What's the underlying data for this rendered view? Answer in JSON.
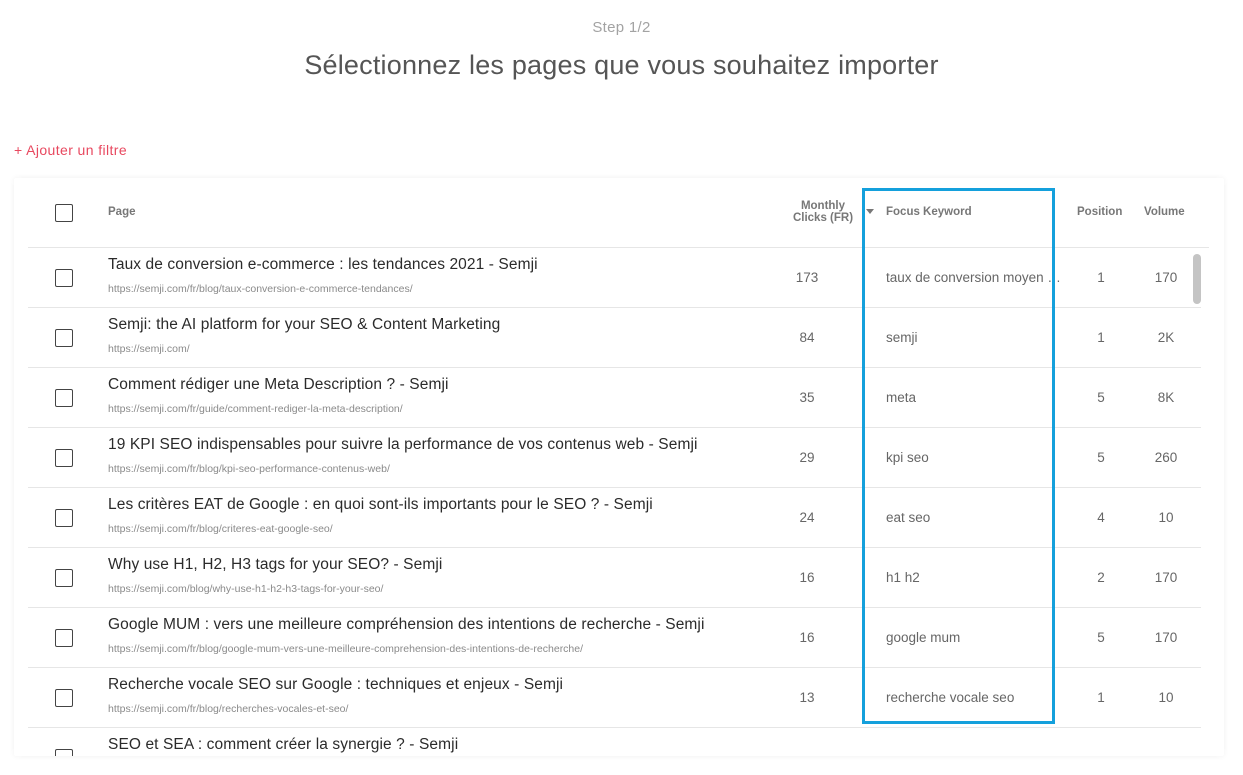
{
  "header": {
    "step": "Step 1/2",
    "title": "Sélectionnez les pages que vous souhaitez importer",
    "add_filter": "+ Ajouter un filtre"
  },
  "table": {
    "columns": {
      "page": "Page",
      "clicks_line1": "Monthly",
      "clicks_line2": "Clicks (FR)",
      "keyword": "Focus Keyword",
      "position": "Position",
      "volume": "Volume"
    },
    "rows": [
      {
        "title": "Taux de conversion e-commerce : les tendances 2021 - Semji",
        "url": "https://semji.com/fr/blog/taux-conversion-e-commerce-tendances/",
        "clicks": "173",
        "keyword": "taux de conversion moyen e-commerce",
        "position": "1",
        "volume": "170"
      },
      {
        "title": "Semji: the AI platform for your SEO & Content Marketing",
        "url": "https://semji.com/",
        "clicks": "84",
        "keyword": "semji",
        "position": "1",
        "volume": "2K"
      },
      {
        "title": "Comment rédiger une Meta Description ? - Semji",
        "url": "https://semji.com/fr/guide/comment-rediger-la-meta-description/",
        "clicks": "35",
        "keyword": "meta",
        "position": "5",
        "volume": "8K"
      },
      {
        "title": "19 KPI SEO indispensables pour suivre la performance de vos contenus web - Semji",
        "url": "https://semji.com/fr/blog/kpi-seo-performance-contenus-web/",
        "clicks": "29",
        "keyword": "kpi seo",
        "position": "5",
        "volume": "260"
      },
      {
        "title": "Les critères EAT de Google : en quoi sont-ils importants pour le SEO ? - Semji",
        "url": "https://semji.com/fr/blog/criteres-eat-google-seo/",
        "clicks": "24",
        "keyword": "eat seo",
        "position": "4",
        "volume": "10"
      },
      {
        "title": "Why use H1, H2, H3 tags for your SEO? - Semji",
        "url": "https://semji.com/blog/why-use-h1-h2-h3-tags-for-your-seo/",
        "clicks": "16",
        "keyword": "h1 h2",
        "position": "2",
        "volume": "170"
      },
      {
        "title": "Google MUM : vers une meilleure compréhension des intentions de recherche - Semji",
        "url": "https://semji.com/fr/blog/google-mum-vers-une-meilleure-comprehension-des-intentions-de-recherche/",
        "clicks": "16",
        "keyword": "google mum",
        "position": "5",
        "volume": "170"
      },
      {
        "title": "Recherche vocale SEO sur Google : techniques et enjeux - Semji",
        "url": "https://semji.com/fr/blog/recherches-vocales-et-seo/",
        "clicks": "13",
        "keyword": "recherche vocale seo",
        "position": "1",
        "volume": "10"
      },
      {
        "title": "SEO et SEA : comment créer la synergie ? - Semji",
        "url": "",
        "clicks": "",
        "keyword": "",
        "position": "",
        "volume": ""
      }
    ]
  },
  "colors": {
    "accent": "#e8485f",
    "highlight": "#14a0dc"
  }
}
